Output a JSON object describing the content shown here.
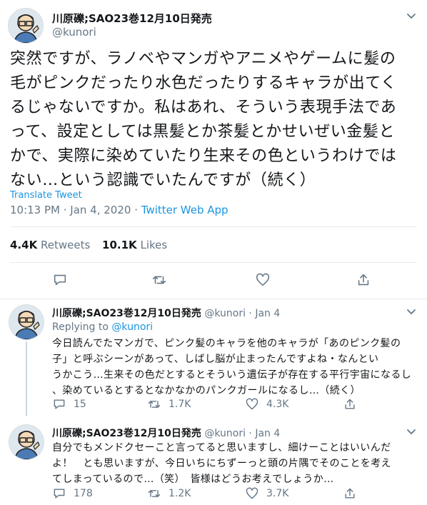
{
  "main_tweet": {
    "author_name": "川原礫;SAO23巻12月10日発売",
    "author_handle": "@kunori",
    "text_lines": [
      "突然ですが、ラノベやマンガやアニメやゲームに髪の",
      "毛がピンクだったり水色だったりするキャラが出てく",
      "るじゃないですか。私はあれ、そういう表現手法であ",
      "って、設定としては黒髪とか茶髪とかせいぜい金髪と",
      "かで、実際に染めていたり生来その色というわけでは",
      "ない…という認識でいたんですが（続く）"
    ],
    "translate_label": "Translate Tweet",
    "time": "10:13 PM · Jan 4, 2020",
    "source": "Twitter Web App",
    "retweets_count": "4.4K",
    "retweets_label": "Retweets",
    "likes_count": "10.1K",
    "likes_label": "Likes"
  },
  "replies": [
    {
      "author_name": "川原礫;SAO23巻12月10日発売",
      "author_handle": "@kunori",
      "date": "Jan 4",
      "replying_prefix": "Replying to",
      "replying_handle": "@kunori",
      "text_lines": [
        "今日読んでたマンガで、ピンク髪のキャラを他のキャラが「あのピンク髪の",
        "子」と呼ぶシーンがあって、しばし脳が止まったんですよね・なんとい",
        "うかこう…生来その色だとするとそういう遺伝子が存在する平行宇宙になるし",
        "、染めているとするとなかなかのパンクガールになるし…（続く）"
      ],
      "reply_count": "15",
      "retweet_count": "1.7K",
      "like_count": "4.3K"
    },
    {
      "author_name": "川原礫;SAO23巻12月10日発売",
      "author_handle": "@kunori",
      "date": "Jan 4",
      "text_lines": [
        "自分でもメンドクセーこと言ってると思いますし、細けーことはいいんだ",
        "よ！　とも思いますが、今日いちにちずーっと頭の片隅でそのことを考え",
        "てしまっているので…（笑）　皆様はどうお考えでしょうか…"
      ],
      "reply_count": "178",
      "retweet_count": "1.2K",
      "like_count": "3.7K"
    }
  ],
  "icons": [
    "avatar",
    "chevron-down-icon",
    "reply-icon",
    "retweet-icon",
    "like-icon",
    "share-icon"
  ],
  "colors": {
    "link": "#1b95e0",
    "secondary": "#657786",
    "border": "#e6ecf0",
    "text": "#14171a"
  }
}
